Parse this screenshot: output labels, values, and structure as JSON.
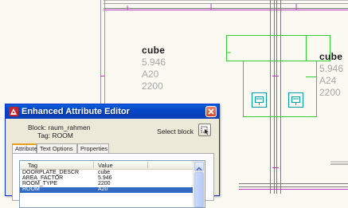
{
  "drawing": {
    "rooms": [
      {
        "name": "cube",
        "area": "5.946",
        "factor": "A20",
        "type": "2200"
      },
      {
        "name": "cube",
        "area": "5.946",
        "factor": "A24",
        "type": "2200"
      }
    ],
    "colors": {
      "background": "#fbfaf2",
      "wall_line": "#7a7a7a",
      "magenta_line": "#c23ac2",
      "green_block": "#33cc33",
      "cyan_symbol": "#00a0b0",
      "attribute_text": "#a6a6a6"
    },
    "symbol_icons": [
      "network-outlet-symbol",
      "network-outlet-symbol"
    ]
  },
  "dialog": {
    "title": "Enhanced Attribute Editor",
    "block_line": "Block: raum_rahmen",
    "tag_line": "Tag: ROOM",
    "select_block_label": "Select block",
    "tabs": [
      "Attribute",
      "Text Options",
      "Properties"
    ],
    "active_tab": "Attribute",
    "columns": {
      "tag": "Tag",
      "value": "Value"
    },
    "rows": [
      {
        "tag": "DOORPLATE_DESCR",
        "value": "cube"
      },
      {
        "tag": "AREA_FACTOR",
        "value": "5.946"
      },
      {
        "tag": "ROOM_TYPE",
        "value": "2200"
      },
      {
        "tag": "ROOM",
        "value": "A20",
        "selected": true
      }
    ],
    "colors": {
      "titlebar": "#0a5fd8",
      "selection": "#316ac5",
      "active_tab_accent": "#e69e1c"
    }
  }
}
